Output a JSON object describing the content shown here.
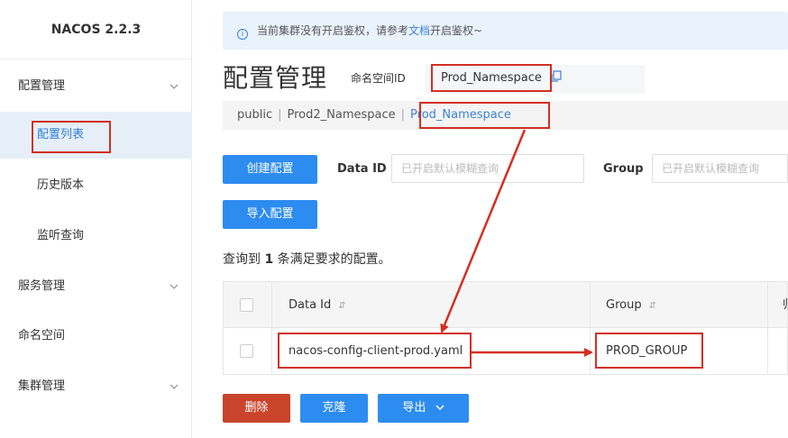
{
  "app": {
    "brand": "NACOS 2.2.3"
  },
  "sidebar": {
    "groups": [
      {
        "label": "配置管理"
      },
      {
        "label": "服务管理"
      },
      {
        "label": "命名空间"
      },
      {
        "label": "集群管理"
      }
    ],
    "subitems": [
      {
        "label": "配置列表"
      },
      {
        "label": "历史版本"
      },
      {
        "label": "监听查询"
      }
    ]
  },
  "notice": {
    "prefix": "当前集群没有开启鉴权，请参考",
    "link": "文档",
    "suffix": "开启鉴权~"
  },
  "header": {
    "title": "配置管理",
    "ns_label": "命名空间ID",
    "ns_value": "Prod_Namespace"
  },
  "namespace_tabs": [
    {
      "label": "public"
    },
    {
      "label": "Prod2_Namespace"
    },
    {
      "label": "Prod_Namespace"
    }
  ],
  "separator": "|",
  "actions": {
    "create": "创建配置",
    "import": "导入配置",
    "delete": "删除",
    "clone": "克隆",
    "export": "导出"
  },
  "filters": {
    "dataid_label": "Data ID",
    "dataid_placeholder": "已开启默认模糊查询",
    "group_label": "Group",
    "group_placeholder": "已开启默认模糊查询"
  },
  "result": {
    "prefix": "查询到",
    "count": "1",
    "suffix": "条满足要求的配置。"
  },
  "table": {
    "columns": [
      "Data Id",
      "Group",
      "归"
    ],
    "sort_glyph": "⇵",
    "rows": [
      {
        "data_id": "nacos-config-client-prod.yaml",
        "group": "PROD_GROUP"
      }
    ]
  },
  "colors": {
    "primary": "#2d8cf0",
    "danger": "#c9442b",
    "annotation": "#d32f22"
  }
}
